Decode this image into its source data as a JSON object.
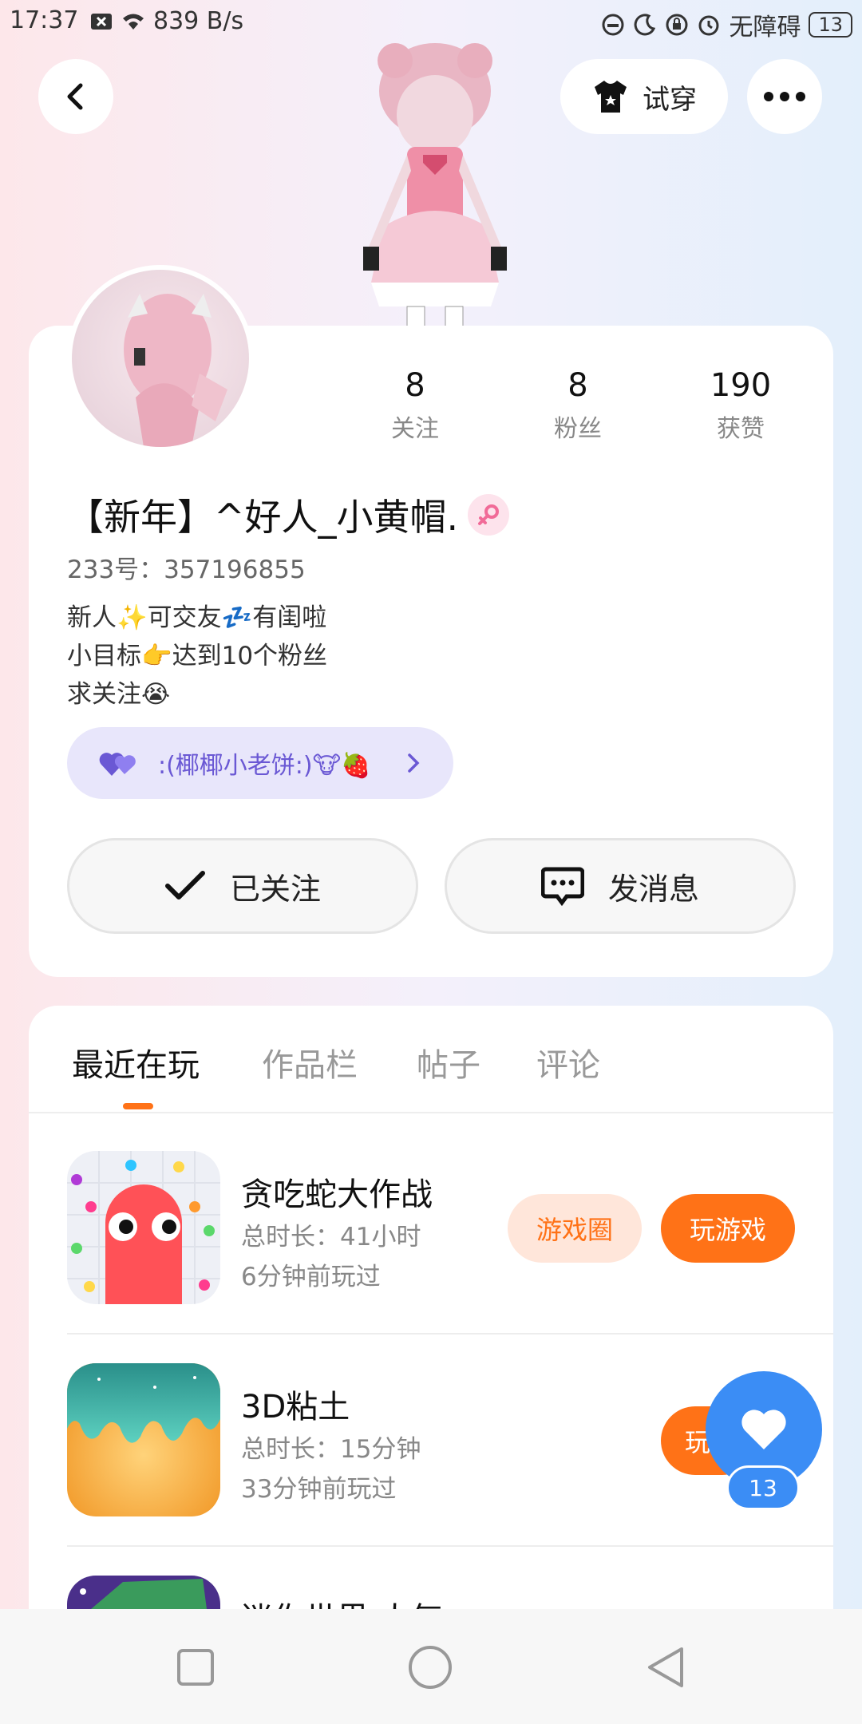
{
  "status_bar": {
    "time": "17:37",
    "net_speed": "839 B/s",
    "accessibility": "无障碍",
    "battery": "13"
  },
  "header": {
    "try_on_label": "试穿"
  },
  "profile": {
    "stats": [
      {
        "num": "8",
        "label": "关注"
      },
      {
        "num": "8",
        "label": "粉丝"
      },
      {
        "num": "190",
        "label": "获赞"
      }
    ],
    "username": "【新年】^好人_小黄帽.",
    "id_line": "233号：357196855",
    "bio": [
      "新人✨可交友💤有闺啦",
      "小目标👉达到10个粉丝",
      "求关注😭"
    ],
    "cp_text": ":(椰椰小老饼:)🐮🍓",
    "follow_label": "已关注",
    "message_label": "发消息"
  },
  "tabs": [
    "最近在玩",
    "作品栏",
    "帖子",
    "评论"
  ],
  "games": [
    {
      "name": "贪吃蛇大作战",
      "duration": "总时长：41小时",
      "last_played": "6分钟前玩过",
      "circle_label": "游戏圈",
      "play_label": "玩游戏"
    },
    {
      "name": "3D粘土",
      "duration": "总时长：15分钟",
      "last_played": "33分钟前玩过",
      "play_label": "玩"
    },
    {
      "name": "迷你世界 人气"
    }
  ],
  "fab": {
    "like_count": "13"
  },
  "colors": {
    "accent": "#ff7217",
    "fab_blue": "#3b8df5",
    "cp_purple": "#6a58d4"
  }
}
